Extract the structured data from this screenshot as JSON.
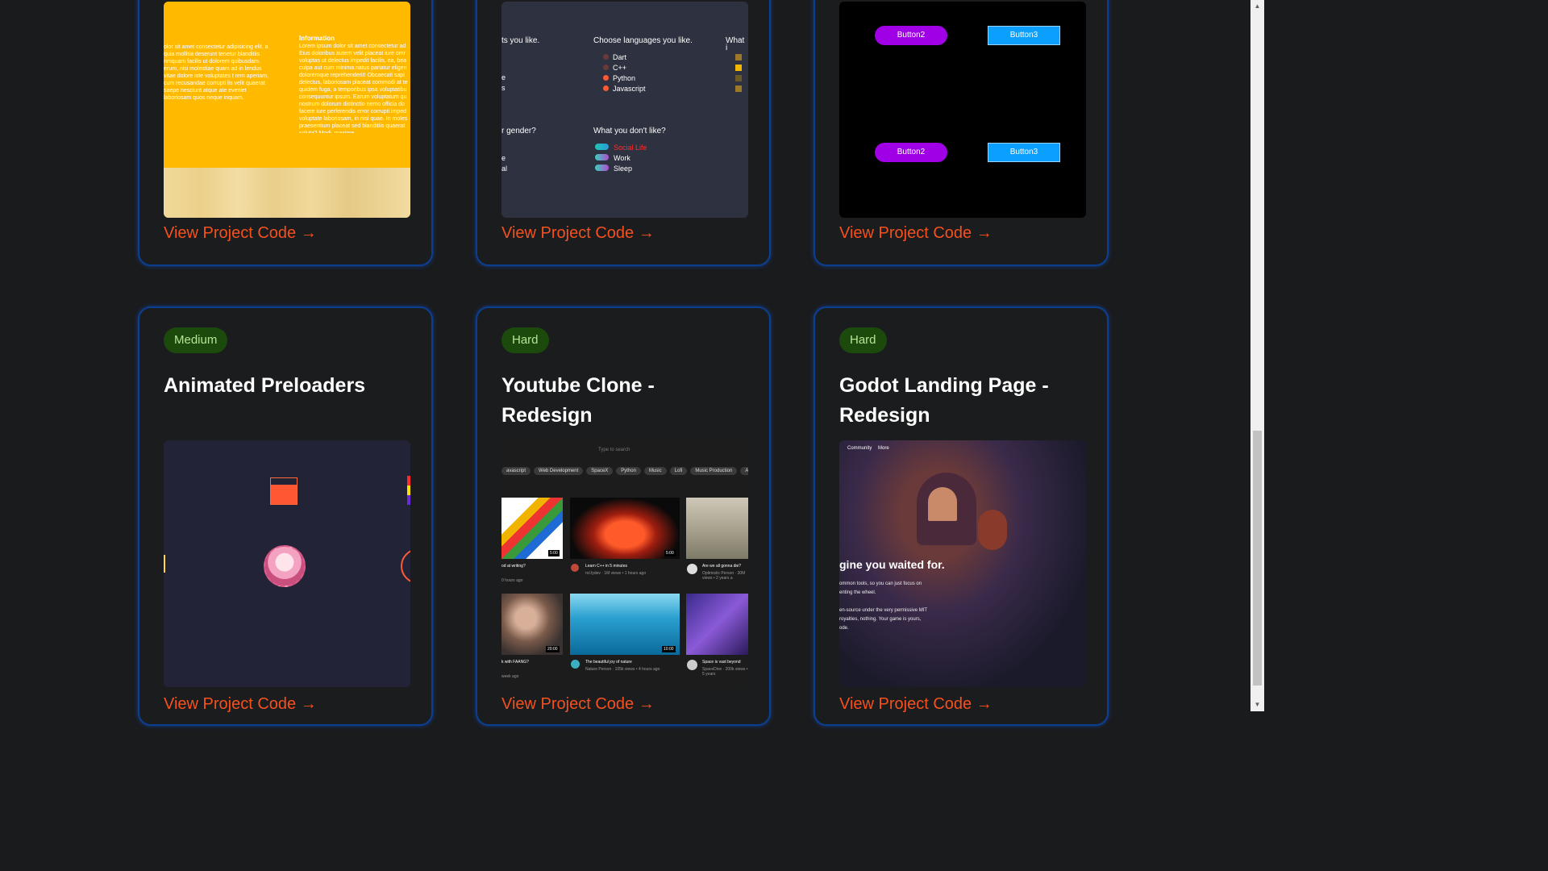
{
  "cards_top": [
    {
      "link": "View Project Code →",
      "preview": {
        "heading": "Information",
        "left_text": "olor sit amet consectetur adipisicing elit. a quia mollitia deserunt tenetur blanditiis nmquam facilis ut dolorem quibusdam. erum, nisi molestiae quam ad in lendus vitae dolore iste voluptates t rem aperiam, cum recusandae corrupti lis velit quaerat saepe nesciunt atque ate eveniet laboriosam quos neque inquam.",
        "right_text": "Lorem ipsum dolor sit amet consectetur ad Eius doloribus autem velit placeat iure omr voluptas ut delectus impedit facilis, ea, bea culpa aut cum minima natus pariatur eligen doloremque reprehenderit! Obcaecati sapi delectus, laboriosam placeat commodi at te quidem fuga, a temporibus ipsa voluptatibu consequuntur ipsum. Earum voluptatum qu nostrum dolorum distinctio nemo officia do facere iure perferendis error corrupti imped voluptate laboriosam, in nisi quae. In moles praesentium placeat sed blanditiis quaerat soluta? Modi, maxime."
      }
    },
    {
      "link": "View Project Code →",
      "preview": {
        "q1": "ts you like.",
        "q2": "Choose languages you like.",
        "q3": "What i",
        "languages": [
          "Dart",
          "C++",
          "Python",
          "Javascript"
        ],
        "q4": "r gender?",
        "q5": "What you don't like?",
        "dislikes": [
          "Social Life",
          "Work",
          "Sleep"
        ],
        "left_marks": [
          "",
          "",
          "e",
          "s"
        ],
        "left_marks2": [
          "e",
          "al"
        ]
      }
    },
    {
      "link": "View Project Code →",
      "preview": {
        "buttons": [
          "Button2",
          "Button3",
          "Button2",
          "Button3"
        ]
      }
    }
  ],
  "cards_bottom": [
    {
      "badge": "Medium",
      "title": "Animated Preloaders",
      "link": "View Project Code →"
    },
    {
      "badge": "Hard",
      "title": "Youtube Clone - Redesign",
      "link": "View Project Code →",
      "preview": {
        "search": "Type to search",
        "chips": [
          "avascript",
          "Web Development",
          "SpaceX",
          "Python",
          "Music",
          "Lofi",
          "Music Production",
          "Anime"
        ],
        "videos": [
          {
            "title": "od at writing?",
            "meta": "0 hours ago",
            "duration": "5:00"
          },
          {
            "title": "Learn C++ in 5 minutes",
            "meta": "rol.fydev · 1M views • 1 hours ago",
            "duration": "5:00"
          },
          {
            "title": "Are we all gonna die?",
            "meta": "Optimistic Person · 30M views • 2 years a",
            "duration": ""
          },
          {
            "title": "k with FAANG?",
            "meta": "week ago",
            "duration": "20:00"
          },
          {
            "title": "The beautiful joy of nature",
            "meta": "Nature Person · 105k views • 4 hours ago",
            "duration": "10:00"
          },
          {
            "title": "Space is vast beyond",
            "meta": "SpaceDive · 200k views • 5 years",
            "duration": ""
          }
        ]
      }
    },
    {
      "badge": "Hard",
      "title": "Godot Landing Page - Redesign",
      "link": "View Project Code →",
      "preview": {
        "nav": [
          "Community",
          "More"
        ],
        "headline": "gine you waited for.",
        "line1": "ommon tools, so you can just focus on",
        "line2": "enting the wheel.",
        "line3": "en-source under the very permissive MIT",
        "line4": "royalties, nothing. Your game is yours,",
        "line5": "ode."
      }
    }
  ],
  "colors": {
    "card_border": "#0b3f91",
    "link": "#f4511e",
    "badge_bg": "#1b4a0c",
    "badge_text": "#b8e496"
  }
}
